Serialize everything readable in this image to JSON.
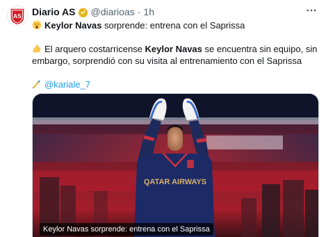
{
  "tweet": {
    "author_name": "Diario AS",
    "author_handle": "@diarioas",
    "separator": "·",
    "time": "1h",
    "avatar_text": "AS",
    "headline_emoji": "surprised-face-icon",
    "headline_bold": "Keylor Navas",
    "headline_rest": " sorprende: entrena con el Saprissa",
    "body_emoji": "flexed-biceps-icon",
    "body_part1": "El arquero costarricense ",
    "body_bold": "Keylor Navas",
    "body_part2": " se encuentra sin equipo, sin embargo, sorprendió con su visita al entrenamiento con el Saprissa",
    "credit_emoji": "writing-hand-icon",
    "credit_handle": "@kariale_7"
  },
  "media": {
    "caption": "Keylor Navas sorprende: entrena con el Saprissa",
    "jersey_sponsor": "QATAR AIRWAYS"
  },
  "colors": {
    "brand_red": "#d21f2a",
    "verified_gold": "#e2b719",
    "link_blue": "#1d9bf0",
    "secondary_text": "#536471"
  }
}
